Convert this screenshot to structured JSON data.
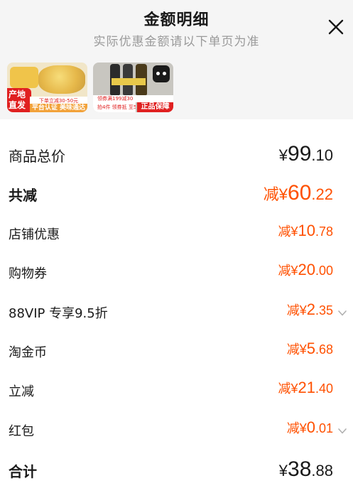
{
  "header": {
    "title": "金额明细",
    "subtitle": "实际优惠金额请以下单页为准"
  },
  "thumbs": {
    "item1": {
      "badge": "产地直发",
      "strip": "下单立减30-50元",
      "strip2": "平台认证 美味通达"
    },
    "item2": {
      "strip": "领券满199减30",
      "strip_b": "拍4件 领券抵 至5折",
      "badge": "正品保障"
    }
  },
  "rows": [
    {
      "label": "商品总价",
      "prefix": "¥",
      "int": "99",
      "dec": ".10"
    },
    {
      "label": "共减",
      "prefix": "减¥",
      "int": "60",
      "dec": ".22"
    },
    {
      "label": "店铺优惠",
      "prefix": "减¥",
      "int": "10",
      "dec": ".78"
    },
    {
      "label": "购物券",
      "prefix": "减¥",
      "int": "20",
      "dec": ".00"
    },
    {
      "label": "88VIP 专享9.5折",
      "prefix": "减¥",
      "int": "2",
      "dec": ".35"
    },
    {
      "label": "淘金币",
      "prefix": "减¥",
      "int": "5",
      "dec": ".68"
    },
    {
      "label": "立减",
      "prefix": "减¥",
      "int": "21",
      "dec": ".40"
    },
    {
      "label": "红包",
      "prefix": "减¥",
      "int": "0",
      "dec": ".01"
    },
    {
      "label": "合计",
      "prefix": "¥",
      "int": "38",
      "dec": ".88"
    }
  ],
  "colors": {
    "accent": "#ff5000",
    "text": "#1a1a1a",
    "muted": "#9a9a9a"
  },
  "icons": {
    "close": "close-icon",
    "expand": "chevron-down-icon"
  }
}
